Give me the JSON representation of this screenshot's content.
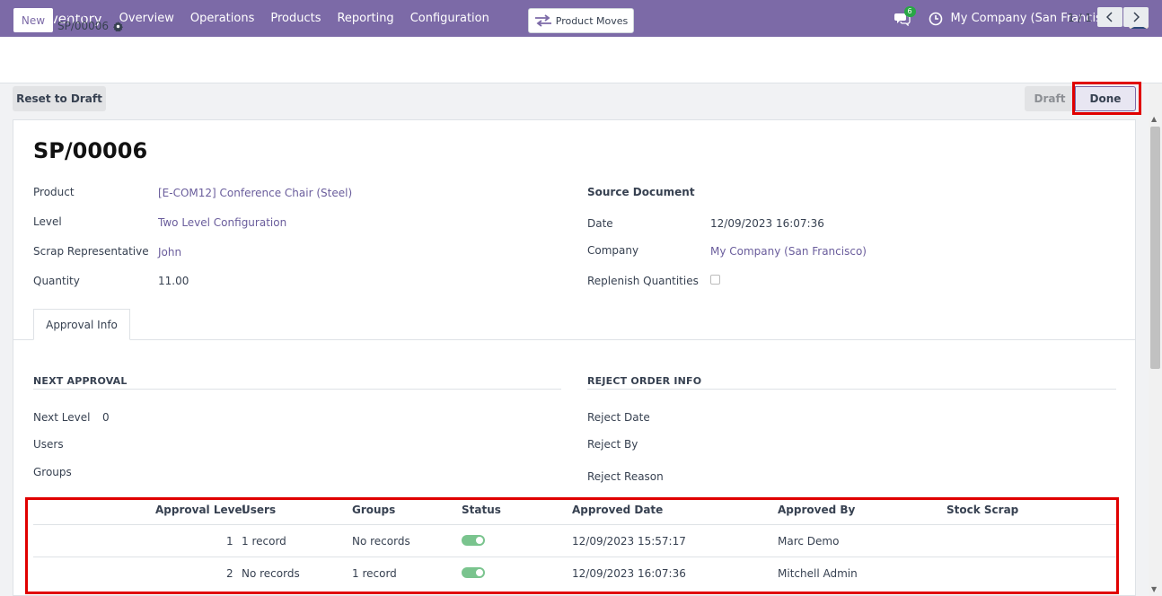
{
  "nav": {
    "app_name": "Inventory",
    "menu": [
      "Overview",
      "Operations",
      "Products",
      "Reporting",
      "Configuration"
    ],
    "chat_badge": "6",
    "company": "My Company (San Francisco)"
  },
  "control": {
    "new_label": "New",
    "breadcrumb": "My Approval",
    "record": "SP/00006",
    "product_moves": "Product Moves",
    "pager": "1 / 1"
  },
  "statusbar": {
    "reset_label": "Reset to Draft",
    "draft": "Draft",
    "done": "Done"
  },
  "form": {
    "title": "SP/00006",
    "product_label": "Product",
    "product": "[E-COM12] Conference Chair (Steel)",
    "level_label": "Level",
    "level": "Two Level Configuration",
    "rep_label": "Scrap Representative",
    "rep": "John",
    "qty_label": "Quantity",
    "qty": "11.00",
    "source_label": "Source Document",
    "date_label": "Date",
    "date": "12/09/2023 16:07:36",
    "company_label": "Company",
    "company": "My Company (San Francisco)",
    "replenish_label": "Replenish Quantities"
  },
  "tab": {
    "label": "Approval Info"
  },
  "next_approval": {
    "title": "NEXT APPROVAL",
    "next_level_label": "Next Level",
    "next_level": "0",
    "users_label": "Users",
    "groups_label": "Groups"
  },
  "reject": {
    "title": "REJECT ORDER INFO",
    "date_label": "Reject Date",
    "by_label": "Reject By",
    "reason_label": "Reject Reason"
  },
  "table": {
    "headers": [
      "Approval Level",
      "Users",
      "Groups",
      "Status",
      "Approved Date",
      "Approved By",
      "Stock Scrap"
    ],
    "rows": [
      {
        "level": "1",
        "users": "1 record",
        "groups": "No records",
        "status": true,
        "date": "12/09/2023 15:57:17",
        "by": "Marc Demo",
        "scrap": ""
      },
      {
        "level": "2",
        "users": "No records",
        "groups": "1 record",
        "status": true,
        "date": "12/09/2023 16:07:36",
        "by": "Mitchell Admin",
        "scrap": ""
      }
    ]
  },
  "colors": {
    "brand": "#7c6aa7",
    "highlight": "#e00000",
    "toggle_on": "#7ac48e"
  }
}
